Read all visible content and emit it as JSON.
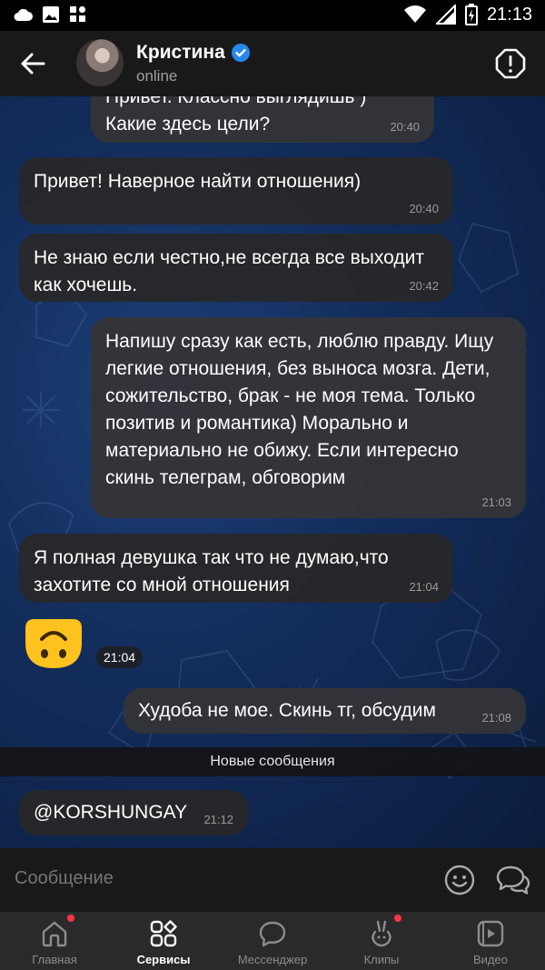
{
  "status_bar": {
    "time": "21:13"
  },
  "header": {
    "contact_name": "Кристина",
    "contact_status": "online"
  },
  "messages": [
    {
      "id": "m1",
      "direction": "outgoing",
      "text": "Привет. Классно выглядишь ) Какие здесь цели?",
      "time": "20:40"
    },
    {
      "id": "m2",
      "direction": "incoming",
      "text": "Привет! Наверное найти отношения)",
      "time": "20:40"
    },
    {
      "id": "m3",
      "direction": "incoming",
      "text": "Не знаю если честно,не всегда все выходит как хочешь.",
      "time": "20:42"
    },
    {
      "id": "m4",
      "direction": "outgoing",
      "text": "Напишу сразу как есть, люблю правду. Ищу легкие отношения, без выноса мозга. Дети, сожительство, брак - не моя тема. Только позитив и романтика) Морально и материально не обижу. Если интересно скинь телеграм, обговорим",
      "time": "21:03"
    },
    {
      "id": "m5",
      "direction": "incoming",
      "text": "Я полная девушка так что не думаю,что захотите со мной отношения",
      "time": "21:04"
    },
    {
      "id": "m6",
      "direction": "incoming",
      "type": "sticker",
      "sticker_icon": "upside-down-face-emoji",
      "time": "21:04"
    },
    {
      "id": "m7",
      "direction": "outgoing",
      "text": "Худоба не мое. Скинь тг, обсудим",
      "time": "21:08"
    },
    {
      "id": "m8",
      "direction": "incoming",
      "text": "@KORSHUNGAY",
      "time": "21:12"
    }
  ],
  "new_messages_divider": "Новые сообщения",
  "composer": {
    "placeholder": "Сообщение"
  },
  "tabs": [
    {
      "label": "Главная",
      "icon": "home-icon",
      "active": false,
      "badge": true
    },
    {
      "label": "Сервисы",
      "icon": "services-grid-icon",
      "active": true,
      "badge": false
    },
    {
      "label": "Мессенджер",
      "icon": "messenger-icon",
      "active": false,
      "badge": false
    },
    {
      "label": "Клипы",
      "icon": "clips-icon",
      "active": false,
      "badge": true
    },
    {
      "label": "Видео",
      "icon": "video-icon",
      "active": false,
      "badge": false
    }
  ],
  "colors": {
    "verified": "#2688eb",
    "badge": "#ff3347",
    "sticker": "#ffc21f",
    "chat_bg": "#122c5a"
  }
}
